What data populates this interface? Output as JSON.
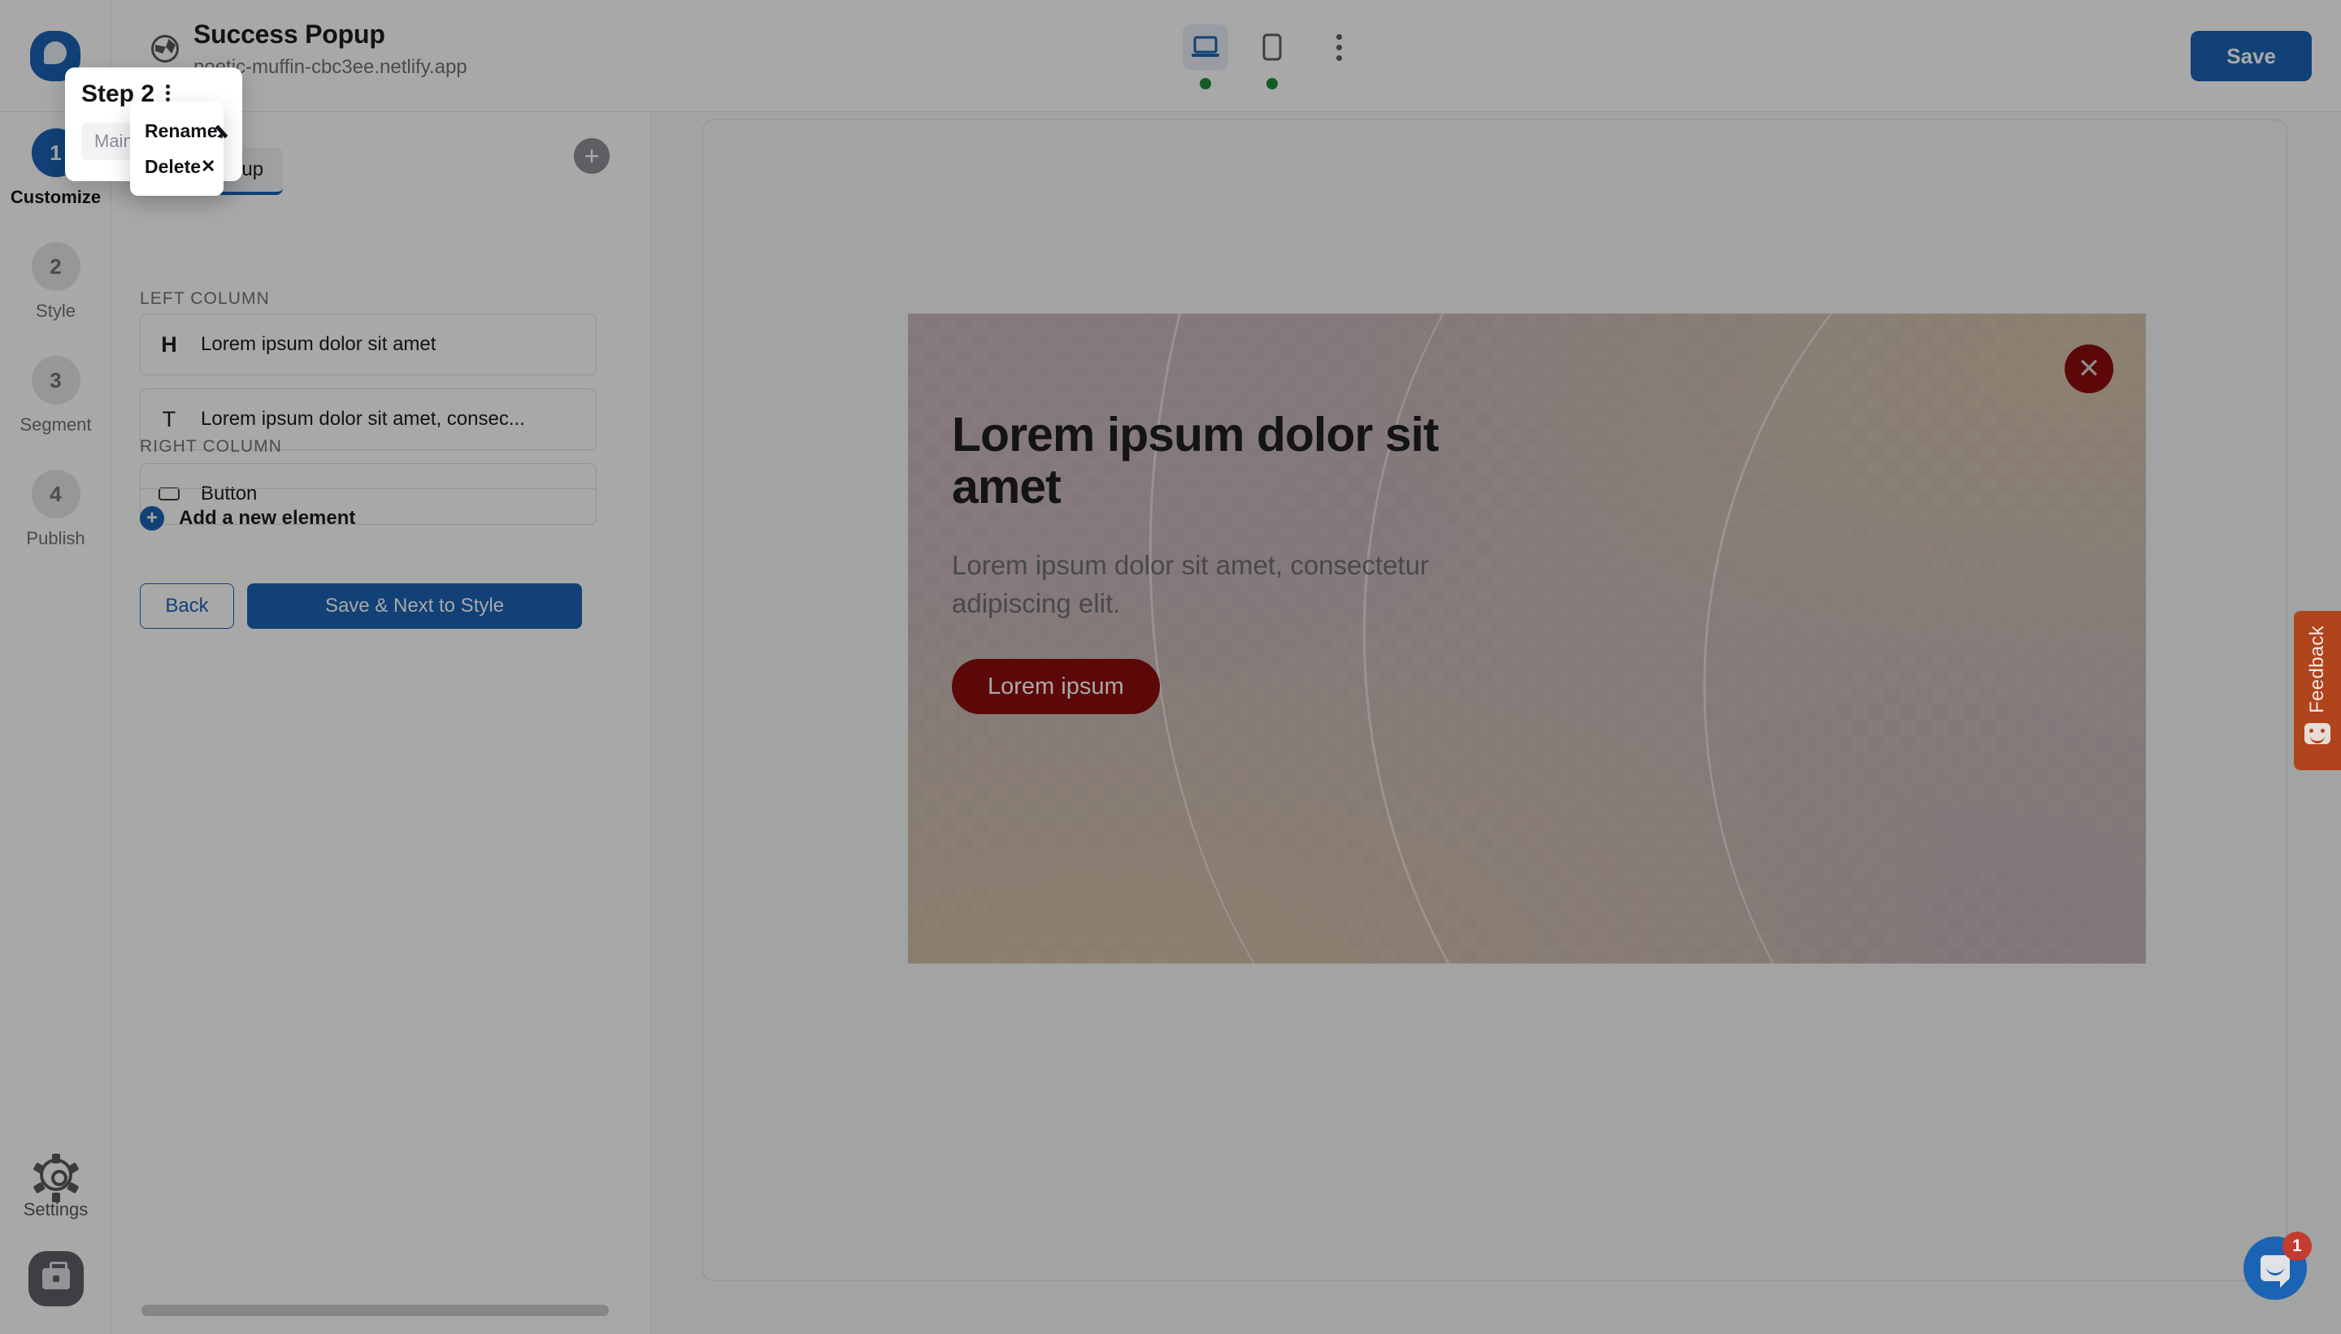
{
  "header": {
    "logo_name": "popup-logo",
    "site_icon": "globe-icon",
    "title": "Success Popup",
    "url": "poetic-muffin-cbc3ee.netlify.app",
    "save_label": "Save",
    "devices": [
      {
        "name": "desktop",
        "icon": "desktop-icon",
        "active": true,
        "status": "online"
      },
      {
        "name": "mobile",
        "icon": "mobile-icon",
        "active": false,
        "status": "online"
      }
    ],
    "more_icon": "kebab-menu-icon"
  },
  "rail": {
    "steps": [
      {
        "number": "1",
        "label": "Customize",
        "active": true
      },
      {
        "number": "2",
        "label": "Style",
        "active": false
      },
      {
        "number": "3",
        "label": "Segment",
        "active": false
      },
      {
        "number": "4",
        "label": "Publish",
        "active": false
      }
    ],
    "settings_label": "Settings",
    "settings_icon": "gear-icon",
    "workspace_icon": "briefcase-icon"
  },
  "editor": {
    "add_step_icon": "plus-icon",
    "tabs": [
      {
        "label": "Main Popup",
        "active": true
      }
    ],
    "left_column_label": "LEFT COLUMN",
    "right_column_label": "RIGHT COLUMN",
    "left_column_elements": [
      {
        "badge": "H",
        "badge_type": "h",
        "text": "Lorem ipsum dolor sit amet"
      },
      {
        "badge": "T",
        "badge_type": "t",
        "text": "Lorem ipsum dolor sit amet, consec..."
      },
      {
        "badge": "",
        "badge_type": "btn",
        "text": "Button"
      }
    ],
    "right_column_elements": [],
    "add_element_label": "Add a new element",
    "add_element_icon": "plus-circle-icon",
    "back_label": "Back",
    "next_label": "Save & Next to Style"
  },
  "step_card": {
    "title": "Step 2",
    "kebab_icon": "kebab-menu-icon",
    "chip_label": "Main Popup"
  },
  "context_menu": {
    "items": [
      {
        "label": "Rename",
        "icon": "pencil-icon"
      },
      {
        "label": "Delete",
        "icon": "close-x-icon"
      }
    ]
  },
  "popup_preview": {
    "heading": "Lorem ipsum dolor sit amet",
    "body": "Lorem ipsum dolor sit amet, consectetur adipiscing elit.",
    "cta_label": "Lorem ipsum",
    "close_icon": "close-x-icon",
    "accent_color": "#8c0d0d",
    "background_color": "#c3aeb0"
  },
  "feedback": {
    "label": "Feedback",
    "icon": "smiley-chat-icon",
    "color": "#b0441c"
  },
  "intercom": {
    "icon": "chat-bubble-icon",
    "badge": "1",
    "color": "#1b63b3"
  }
}
